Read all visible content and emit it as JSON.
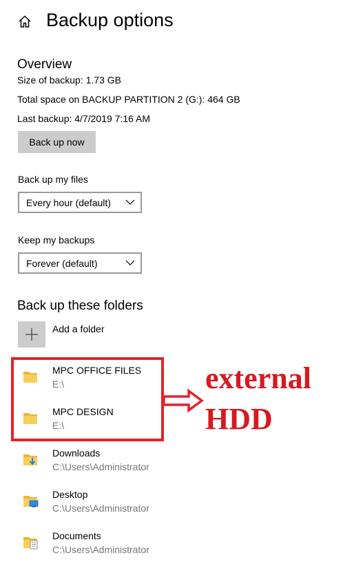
{
  "header": {
    "title": "Backup options",
    "home_icon": "home-icon"
  },
  "overview": {
    "title": "Overview",
    "size_line": "Size of backup: 1.73 GB",
    "space_line": "Total space on BACKUP PARTITION 2 (G:): 464 GB",
    "last_line": "Last backup: 4/7/2019 7:16 AM",
    "backup_button": "Back up now"
  },
  "backup_files": {
    "label": "Back up my files",
    "selected": "Every hour (default)"
  },
  "keep_backups": {
    "label": "Keep my backups",
    "selected": "Forever (default)"
  },
  "folders": {
    "title": "Back up these folders",
    "add_label": "Add a folder",
    "items": [
      {
        "name": "MPC OFFICE FILES",
        "path": "E:\\",
        "icon": "folder-icon"
      },
      {
        "name": "MPC DESIGN",
        "path": "E:\\",
        "icon": "folder-icon"
      },
      {
        "name": "Downloads",
        "path": "C:\\Users\\Administrator",
        "icon": "downloads-folder-icon"
      },
      {
        "name": "Desktop",
        "path": "C:\\Users\\Administrator",
        "icon": "desktop-folder-icon"
      },
      {
        "name": "Documents",
        "path": "C:\\Users\\Administrator",
        "icon": "documents-folder-icon"
      }
    ]
  },
  "annotation": {
    "line1": "external",
    "line2": "HDD",
    "color": "#d71920"
  },
  "colors": {
    "button_bg": "#cccccc",
    "secondary_text": "#767676",
    "folder_yellow": "#f5c542",
    "highlight_red": "#e0242a"
  }
}
